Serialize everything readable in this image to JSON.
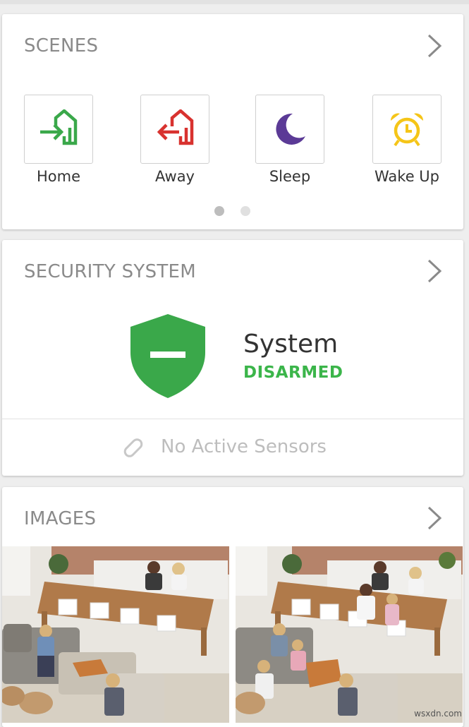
{
  "scenes": {
    "title": "SCENES",
    "items": [
      {
        "label": "Home",
        "icon": "home-enter-icon",
        "color": "#3aa84a"
      },
      {
        "label": "Away",
        "icon": "home-leave-icon",
        "color": "#d8322f"
      },
      {
        "label": "Sleep",
        "icon": "moon-icon",
        "color": "#5b3a96"
      },
      {
        "label": "Wake Up",
        "icon": "alarm-clock-icon",
        "color": "#f5c518"
      }
    ],
    "pages": 2,
    "active_page": 1
  },
  "security": {
    "title": "SECURITY SYSTEM",
    "system_label": "System",
    "status": "DISARMED",
    "status_color": "#3bb54a",
    "shield_icon": "shield-disarmed-icon",
    "sensors_text": "No Active Sensors",
    "sensors_icon": "sensor-pill-icon"
  },
  "images": {
    "title": "IMAGES",
    "items": [
      {
        "name": "camera-image-1"
      },
      {
        "name": "camera-image-2"
      }
    ]
  },
  "watermark": "wsxdn.com"
}
